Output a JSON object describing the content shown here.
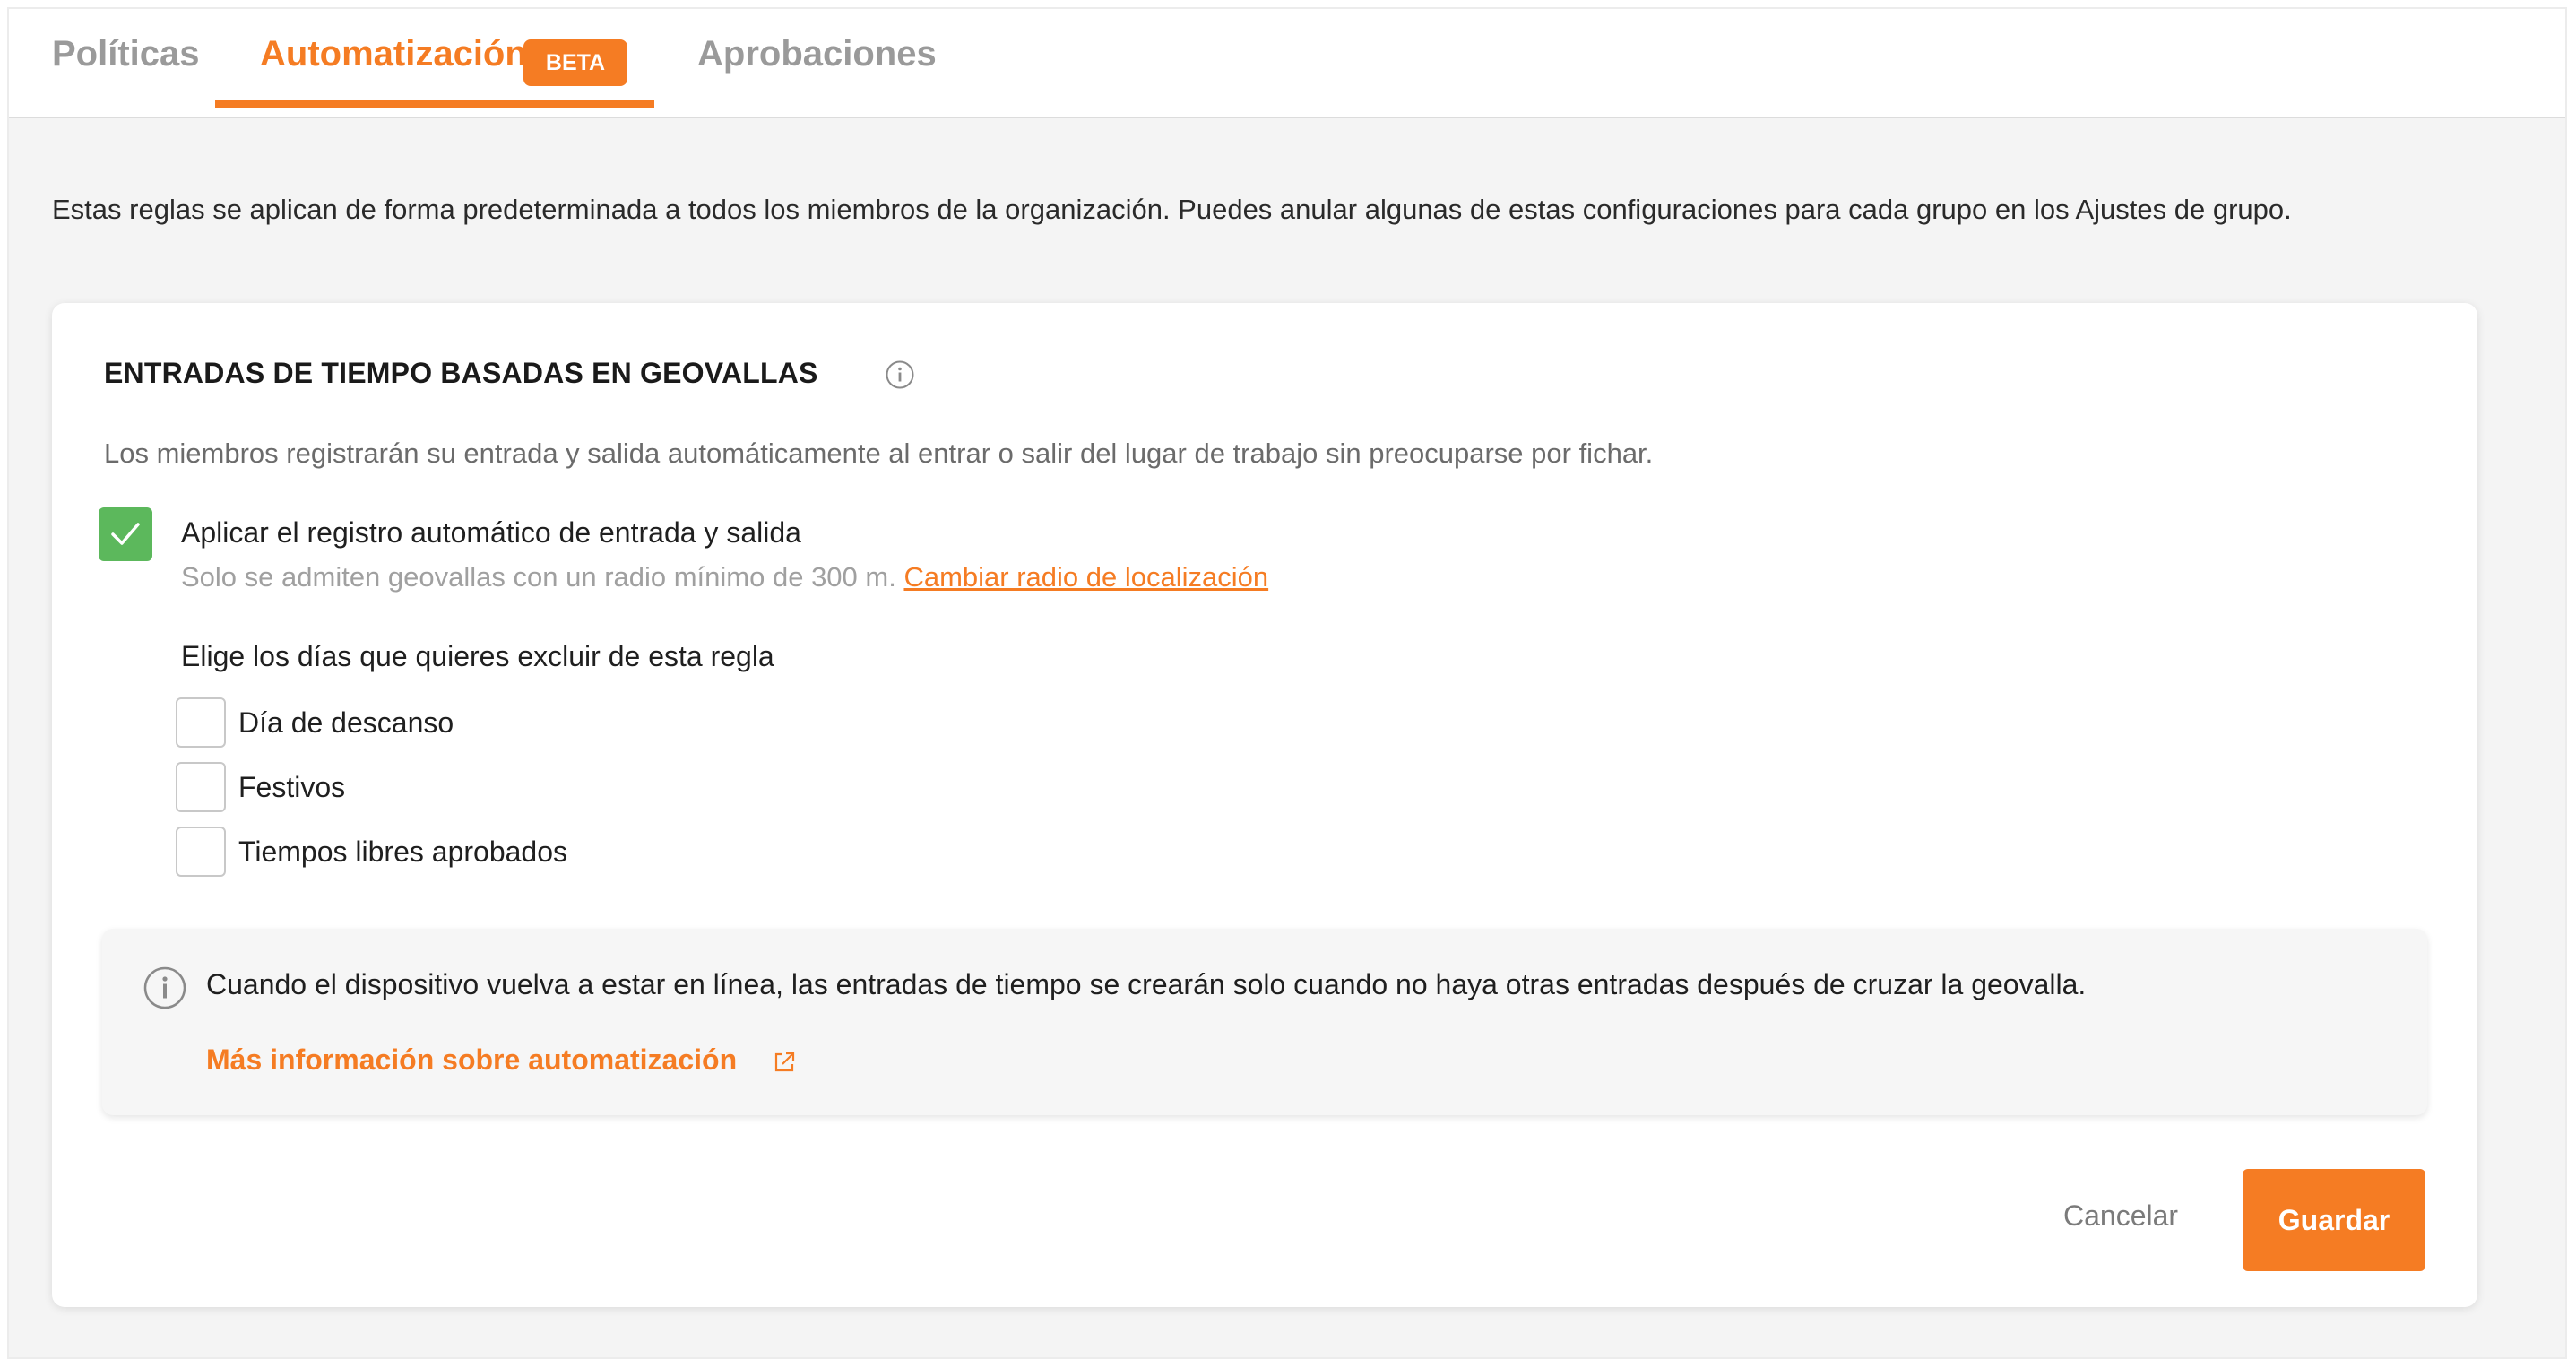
{
  "tabs": [
    {
      "label": "Políticas",
      "active": false
    },
    {
      "label": "Automatización",
      "active": true,
      "badge": "BETA"
    },
    {
      "label": "Aprobaciones",
      "active": false
    }
  ],
  "intro": "Estas reglas se aplican de forma predeterminada a todos los miembros de la organización. Puedes anular algunas de estas configuraciones para cada grupo en los Ajustes de grupo.",
  "section": {
    "title": "ENTRADAS DE TIEMPO BASADAS EN GEOVALLAS",
    "description": "Los miembros registrarán su entrada y salida automáticamente al entrar o salir del lugar de trabajo sin preocuparse por fichar.",
    "apply_checkbox": {
      "label": "Aplicar el registro automático de entrada y salida",
      "checked": true,
      "note": "Solo se admiten geovallas con un radio mínimo de 300 m.",
      "note_link": "Cambiar radio de localización"
    },
    "exclude_title": "Elige los días que quieres excluir de esta regla",
    "exclude_options": [
      {
        "label": "Día de descanso",
        "checked": false
      },
      {
        "label": "Festivos",
        "checked": false
      },
      {
        "label": "Tiempos libres aprobados",
        "checked": false
      }
    ],
    "notice": {
      "text": "Cuando el dispositivo vuelva a estar en línea, las entradas de tiempo se crearán solo cuando no haya otras entradas después de cruzar la geovalla.",
      "link": "Más información sobre automatización"
    }
  },
  "actions": {
    "cancel": "Cancelar",
    "save": "Guardar"
  },
  "colors": {
    "accent": "#f57c23",
    "check_green": "#5cb85c"
  }
}
